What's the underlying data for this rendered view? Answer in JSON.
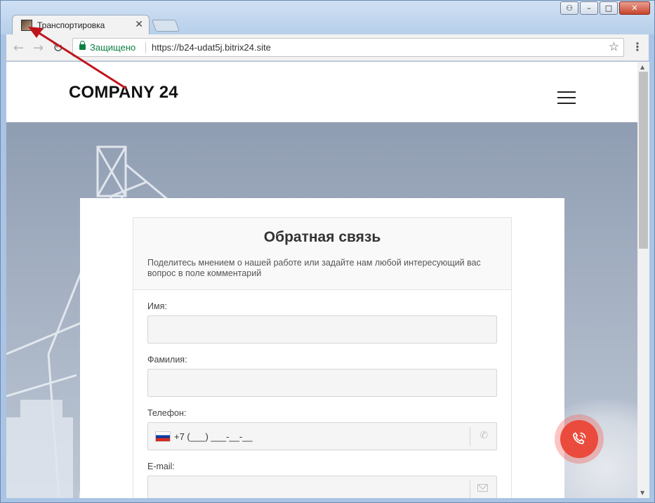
{
  "browser": {
    "tab_title": "Транспортировка",
    "tab_close": "✕",
    "new_tab": "",
    "secure_label": "Защищено",
    "url": "https://b24-udat5j.bitrix24.site",
    "icons": {
      "back": "arrow-left-icon",
      "forward": "arrow-right-icon",
      "reload": "reload-icon",
      "star": "star-icon",
      "menu": "kebab-menu-icon"
    },
    "window_buttons": {
      "user": "⚇",
      "minimize": "–",
      "maximize": "□",
      "close": "✕"
    }
  },
  "site": {
    "logo": "COMPANY 24"
  },
  "form": {
    "title": "Обратная связь",
    "subtitle": "Поделитесь мнением о нашей работе или задайте нам любой интересующий вас вопрос в поле комментарий",
    "fields": {
      "name_label": "Имя:",
      "surname_label": "Фамилия:",
      "phone_label": "Телефон:",
      "phone_mask": "+7 (___) ___-__-__",
      "email_label": "E-mail:"
    }
  },
  "colors": {
    "secure": "#0b8043",
    "call_button": "#ea4b3c",
    "annotation_arrow": "#c0141c"
  }
}
